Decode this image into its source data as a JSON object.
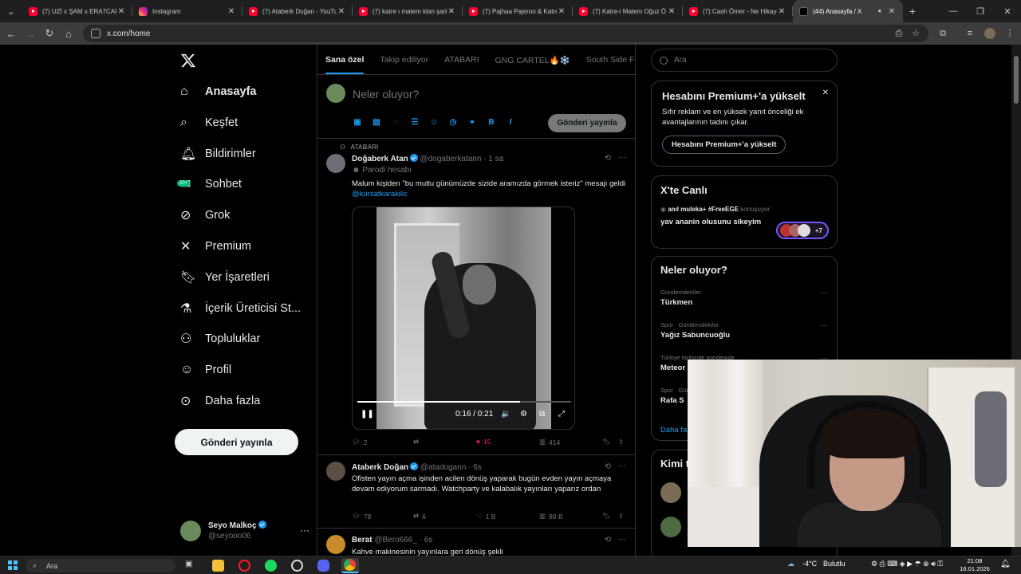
{
  "browser": {
    "tabs": [
      {
        "title": "(7) UZİ x ŞAM x ERA7CAPONE",
        "icon": "youtube-icon",
        "active": false
      },
      {
        "title": "Instagram",
        "icon": "instagram-icon",
        "active": false
      },
      {
        "title": "(7) Ataberk Doğan - YouTube",
        "icon": "youtube-icon",
        "active": false
      },
      {
        "title": "(7) katre ı matem klan şarkı",
        "icon": "youtube-icon",
        "active": false
      },
      {
        "title": "(7) Pajhaa Pajeroo & Katre",
        "icon": "youtube-icon",
        "active": false
      },
      {
        "title": "(7) Katre-i Matem Oğuz Ö",
        "icon": "youtube-icon",
        "active": false
      },
      {
        "title": "(7) Cash Ömer - Ne Hikaye",
        "icon": "youtube-icon",
        "active": false
      },
      {
        "title": "(44) Anasayfa / X",
        "icon": "x-icon",
        "active": true
      }
    ],
    "url": "x.com/home"
  },
  "nav": {
    "items": [
      {
        "label": "Anasayfa",
        "icon": "home-icon"
      },
      {
        "label": "Keşfet",
        "icon": "search-icon"
      },
      {
        "label": "Bildirimler",
        "icon": "bell-icon"
      },
      {
        "label": "Sohbet",
        "icon": "mail-icon",
        "badge": "20+"
      },
      {
        "label": "Grok",
        "icon": "grok-icon"
      },
      {
        "label": "Premium",
        "icon": "x-icon"
      },
      {
        "label": "Yer İşaretleri",
        "icon": "bookmark-icon"
      },
      {
        "label": "İçerik Üreticisi St...",
        "icon": "flask-icon"
      },
      {
        "label": "Topluluklar",
        "icon": "communities-icon"
      },
      {
        "label": "Profil",
        "icon": "person-icon"
      },
      {
        "label": "Daha fazla",
        "icon": "more-circle-icon"
      }
    ],
    "post_button": "Gönderi yayınla",
    "account": {
      "name": "Seyo Malkoç",
      "handle": "@seyooo06"
    }
  },
  "feed": {
    "tabs": [
      "Sana özel",
      "Takip ediliyor",
      "ATABARI",
      "GNG CARTEL🔥❄️",
      "South Side Fi"
    ],
    "composer": {
      "placeholder": "Neler oluyor?",
      "post_label": "Gönderi yayınla"
    },
    "tweets": [
      {
        "context": "ATABARI",
        "name": "Doğaberk Atan",
        "handle": "@dogaberkatann",
        "time": "· 1 sa",
        "label": "Parodi hesabı",
        "text": "Malum kişiden \"bu mutlu günümüzde sizide aramızda görmek isteriz\" mesajı geldi ",
        "mention": "@kursatkarakilic",
        "video": {
          "time": "0:16 / 0:21",
          "progress": 0.76
        },
        "replies": "2",
        "reposts": "",
        "likes": "15",
        "views": "414"
      },
      {
        "name": "Ataberk Doğan",
        "handle": "@atadogann",
        "time": "· 6s",
        "text": "Ofisten yayın açma işinden acilen dönüş yaparak bugün evden yayın açmaya devam ediyorum sarmadı. Watchparty ve kalabalık yayınları yaparız ordan",
        "replies": "78",
        "reposts": "6",
        "likes": "1 B",
        "views": "88 B"
      },
      {
        "name": "Berat",
        "handle": "@Bero666_",
        "time": "· 6s",
        "text": "Kahve makinesinin yayınlara geri dönüş şekli"
      }
    ]
  },
  "sidebar": {
    "search_placeholder": "Ara",
    "premium": {
      "title": "Hesabını Premium+'a yükselt",
      "body": "Sıfır reklam ve en yüksek yanıt önceliği ek avantajlarının tadını çıkar.",
      "button": "Hesabını Premium+'a yükselt"
    },
    "live": {
      "title": "X'te Canlı",
      "speaker": "anıl muleka+ #FreeEGE",
      "suffix": "konuşuyor",
      "line": "yav ananin olusunu sikeyim",
      "count": "+7"
    },
    "trends": {
      "title": "Neler oluyor?",
      "items": [
        {
          "category": "Gündemdekiler",
          "name": "Türkmen"
        },
        {
          "category": "Spor · Gündemdekiler",
          "name": "Yağız Sabuncuoğlu"
        },
        {
          "category": "Türkiye tarihinde gündemde",
          "name": "Meteor"
        },
        {
          "category": "Spor · Gündemdekiler",
          "name": "Rafa S"
        }
      ],
      "more": "Daha fa"
    },
    "follow_title": "Kimi t"
  },
  "taskbar": {
    "search": "Ara",
    "weather": "-4°C",
    "weather_text": "Bulutlu",
    "time": "21:08",
    "date": "16.01.2026"
  },
  "colors": {
    "accent": "#1d9bf0",
    "like": "#f91880",
    "background": "#000000"
  }
}
